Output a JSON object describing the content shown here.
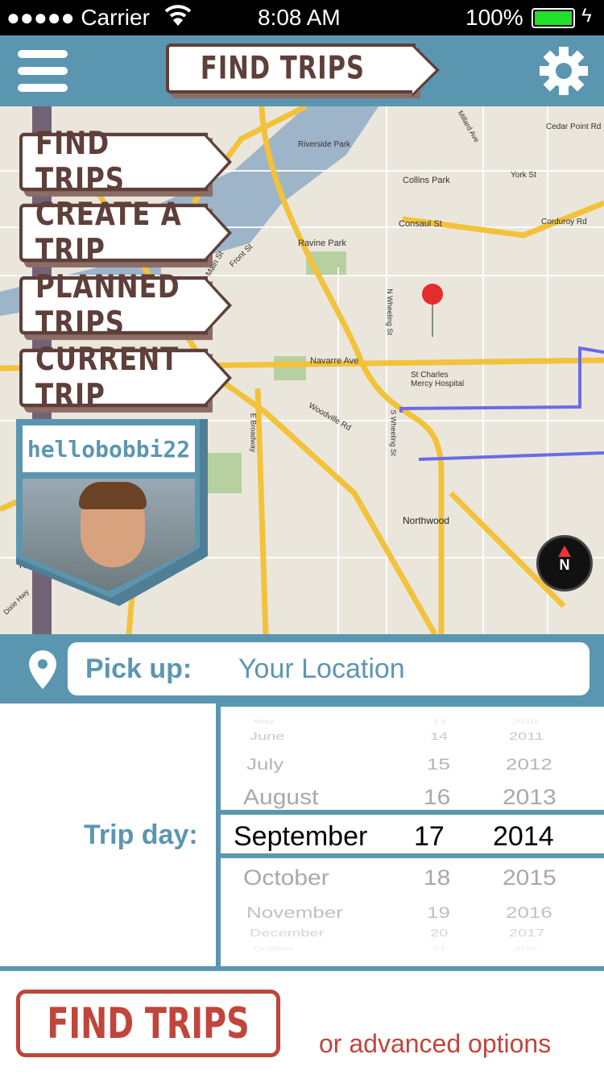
{
  "status": {
    "carrier": "●●●●● Carrier",
    "time": "8:08 AM",
    "battery": "100%"
  },
  "header": {
    "title": "FIND TRIPS",
    "menu_icon": "hamburger-icon",
    "settings_icon": "gear-icon"
  },
  "menu": {
    "items": [
      {
        "label": "FIND TRIPS"
      },
      {
        "label": "CREATE A TRIP"
      },
      {
        "label": "PLANNED TRIPS"
      },
      {
        "label": "CURRENT TRIP"
      }
    ]
  },
  "profile": {
    "username": "hellobobbi22"
  },
  "map": {
    "labels": [
      "Riverside Park",
      "Collins Park",
      "Consaul St",
      "Ravine Park",
      "Navarre Ave",
      "St Charles Mercy Hospital",
      "Northwood",
      "Woodville Rd",
      "Cedar Point Rd",
      "York St",
      "Corduroy Rd",
      "Rossford",
      "E Broadway",
      "S Wheeling St",
      "N Wheeling St",
      "Front St",
      "Main St",
      "Millard Ave",
      "Dixie Hwy"
    ],
    "compass": "N"
  },
  "pickup": {
    "label": "Pick up:",
    "value": "Your Location"
  },
  "trip_day": {
    "label": "Trip day:",
    "months": [
      "May",
      "June",
      "July",
      "August",
      "September",
      "October",
      "November",
      "December",
      "October"
    ],
    "days": [
      "13",
      "14",
      "15",
      "16",
      "17",
      "18",
      "19",
      "20",
      "21"
    ],
    "years": [
      "2010",
      "2011",
      "2012",
      "2013",
      "2014",
      "2015",
      "2016",
      "2017",
      "2018"
    ],
    "selected": {
      "month": "September",
      "day": "17",
      "year": "2014"
    }
  },
  "actions": {
    "find_trips": "FIND TRIPS",
    "advanced": "or advanced options"
  },
  "colors": {
    "header": "#5b96b0",
    "brown": "#5e3f3a",
    "accent_red": "#c0453b",
    "battery": "#22e02a"
  }
}
